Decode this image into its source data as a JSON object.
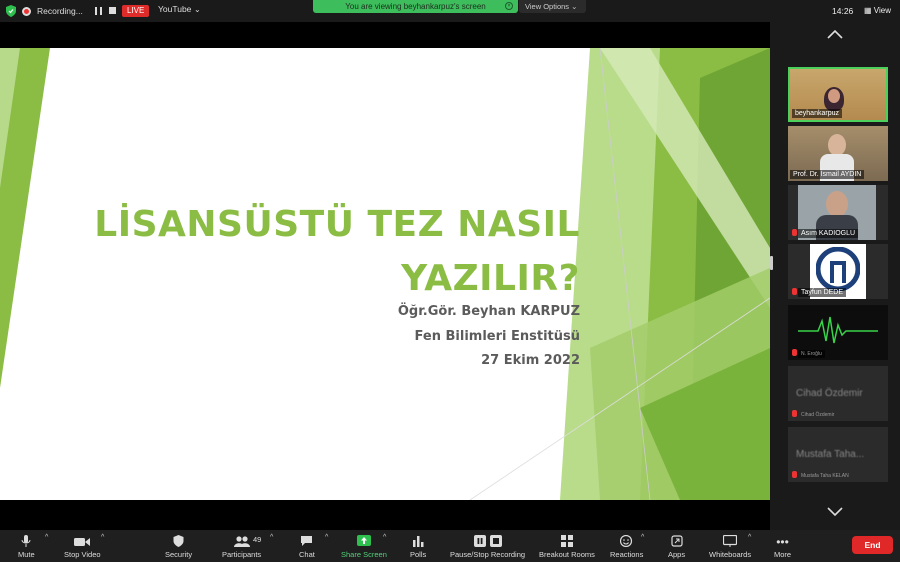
{
  "top_bar": {
    "recording_label": "Recording...",
    "live_badge": "LIVE",
    "stream_target": "YouTube",
    "viewing_banner": "You are viewing beyhankarpuz's screen",
    "view_options": "View Options",
    "clock": "14:26",
    "view_label": "View"
  },
  "slide": {
    "title_line1": "LİSANSÜSTÜ TEZ NASIL",
    "title_line2": "YAZILIR?",
    "presenter": "Öğr.Gör. Beyhan KARPUZ",
    "institute": "Fen Bilimleri Enstitüsü",
    "date": "27 Ekim 2022"
  },
  "participants": [
    {
      "name": "beyhankarpuz",
      "active": true
    },
    {
      "name": "Prof. Dr. İsmail AYDIN",
      "muted": false
    },
    {
      "name": "Asım KADIOGLU",
      "muted": true
    },
    {
      "name": "Tayfun DEDE",
      "muted": true
    },
    {
      "name": "N. Eroğlu",
      "muted": true
    },
    {
      "name": "Cihad Özdemir",
      "video_text": "Cihad Özdemir",
      "muted": true
    },
    {
      "name": "Mustafa Taha KELAN",
      "video_text": "Mustafa Taha...",
      "muted": true
    }
  ],
  "toolbar": {
    "mute": "Mute",
    "stop_video": "Stop Video",
    "security": "Security",
    "participants": "Participants",
    "participants_count": "49",
    "chat": "Chat",
    "share_screen": "Share Screen",
    "polls": "Polls",
    "pause_stop_recording": "Pause/Stop Recording",
    "breakout_rooms": "Breakout Rooms",
    "reactions": "Reactions",
    "apps": "Apps",
    "whiteboards": "Whiteboards",
    "more": "More",
    "end": "End"
  },
  "colors": {
    "slide_green": "#8bbd45",
    "active_border": "#4cd05c",
    "end_red": "#e02828",
    "share_green": "#52d27a"
  }
}
